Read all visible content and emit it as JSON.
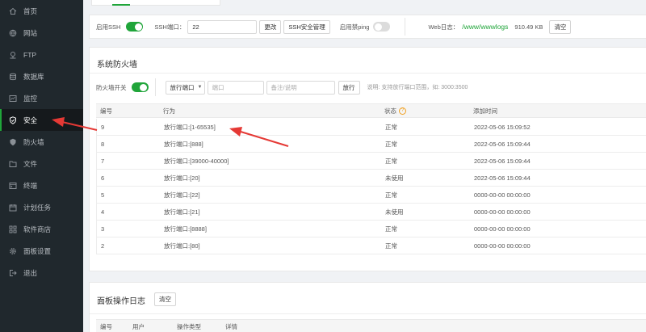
{
  "sidebar": {
    "items": [
      {
        "label": "首页",
        "icon": "home-icon"
      },
      {
        "label": "网站",
        "icon": "globe-icon"
      },
      {
        "label": "FTP",
        "icon": "ftp-icon"
      },
      {
        "label": "数据库",
        "icon": "database-icon"
      },
      {
        "label": "监控",
        "icon": "monitor-icon"
      },
      {
        "label": "安全",
        "icon": "shield-icon"
      },
      {
        "label": "防火墙",
        "icon": "firewall-icon"
      },
      {
        "label": "文件",
        "icon": "folder-icon"
      },
      {
        "label": "终端",
        "icon": "terminal-icon"
      },
      {
        "label": "计划任务",
        "icon": "calendar-icon"
      },
      {
        "label": "软件商店",
        "icon": "apps-icon"
      },
      {
        "label": "面板设置",
        "icon": "gear-icon"
      },
      {
        "label": "退出",
        "icon": "logout-icon"
      }
    ],
    "active_index": 5
  },
  "ssh_bar": {
    "enable_ssh_label": "启用SSH",
    "ssh_port_label": "SSH端口：",
    "ssh_port_value": "22",
    "change_button": "更改",
    "ssh_manage_button": "SSH安全管理",
    "ping_label": "启用禁ping",
    "weblog_label": "Web日志：",
    "weblog_path": "/www/wwwlogs",
    "weblog_size": "910.49 KB",
    "clear_button": "清空"
  },
  "firewall": {
    "title": "系统防火墙",
    "switch_label": "防火墙开关",
    "select_value": "放行端口",
    "port_placeholder": "端口",
    "note_placeholder": "备注/说明",
    "allow_button": "放行",
    "hint": "说明: 支持放行端口范围，如: 3000:3500",
    "columns": {
      "id": "编号",
      "action": "行为",
      "status": "状态",
      "time": "添加时间"
    },
    "rows": [
      {
        "id": "9",
        "action": "放行端口:[1-65535]",
        "status": "正常",
        "time": "2022-05-06 15:09:52"
      },
      {
        "id": "8",
        "action": "放行端口:[888]",
        "status": "正常",
        "time": "2022-05-06 15:09:44"
      },
      {
        "id": "7",
        "action": "放行端口:[39000-40000]",
        "status": "正常",
        "time": "2022-05-06 15:09:44"
      },
      {
        "id": "6",
        "action": "放行端口:[20]",
        "status": "未使用",
        "time": "2022-05-06 15:09:44"
      },
      {
        "id": "5",
        "action": "放行端口:[22]",
        "status": "正常",
        "time": "0000-00-00 00:00:00"
      },
      {
        "id": "4",
        "action": "放行端口:[21]",
        "status": "未使用",
        "time": "0000-00-00 00:00:00"
      },
      {
        "id": "3",
        "action": "放行端口:[8888]",
        "status": "正常",
        "time": "0000-00-00 00:00:00"
      },
      {
        "id": "2",
        "action": "放行端口:[80]",
        "status": "正常",
        "time": "0000-00-00 00:00:00"
      }
    ]
  },
  "panel_log": {
    "title": "面板操作日志",
    "clear_button": "清空",
    "columns": {
      "id": "编号",
      "user": "用户",
      "type": "操作类型",
      "detail": "详情"
    }
  },
  "colors": {
    "accent": "#20a53a",
    "sidebar_bg": "#20282d",
    "arrow": "#e53935"
  }
}
